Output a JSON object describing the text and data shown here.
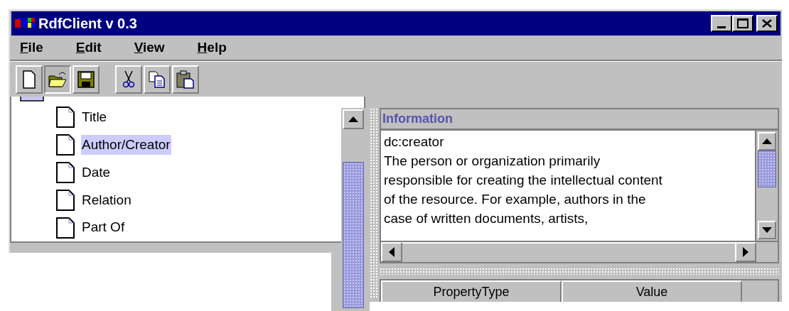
{
  "window": {
    "title": "RdfClient v 0.3"
  },
  "menu": [
    {
      "label": "File"
    },
    {
      "label": "Edit"
    },
    {
      "label": "View"
    },
    {
      "label": "Help"
    }
  ],
  "toolbar": [
    {
      "kind": "new"
    },
    {
      "kind": "open",
      "selected": true
    },
    {
      "kind": "save"
    },
    {
      "kind": "cut"
    },
    {
      "kind": "copy"
    },
    {
      "kind": "paste"
    }
  ],
  "tree": {
    "items": [
      {
        "label": "Title",
        "selected": false
      },
      {
        "label": "Author/Creator",
        "selected": true
      },
      {
        "label": "Date",
        "selected": false
      },
      {
        "label": "Relation",
        "selected": false
      },
      {
        "label": "Part Of",
        "selected": false
      }
    ]
  },
  "information": {
    "title": "Information",
    "term": "dc:creator",
    "description_lines": [
      "The person or organization primarily",
      "responsible for creating the intellectual content",
      "of the resource. For example, authors in the",
      "case of written documents, artists,"
    ]
  },
  "table": {
    "columns": [
      "PropertyType",
      "Value"
    ]
  }
}
